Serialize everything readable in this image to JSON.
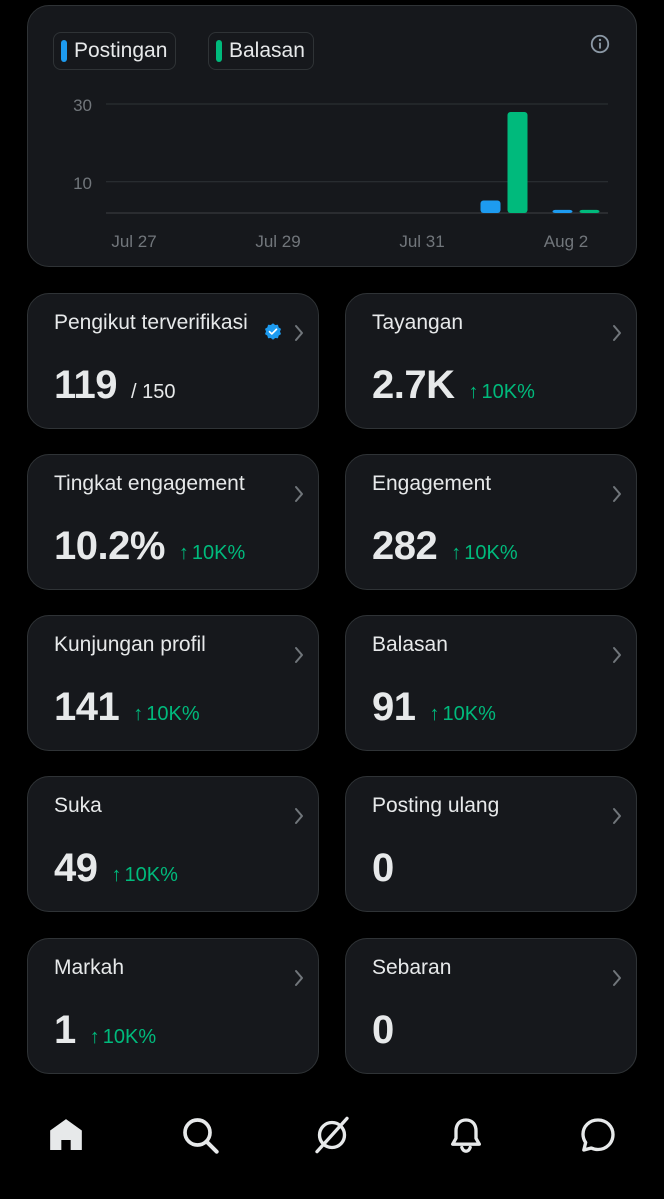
{
  "chart": {
    "legend": [
      {
        "label": "Postingan",
        "color": "#1d9bf0"
      },
      {
        "label": "Balasan",
        "color": "#00ba7c"
      }
    ]
  },
  "chart_data": {
    "type": "bar",
    "x_ticks": [
      "Jul 27",
      "Jul 29",
      "Jul 31",
      "Aug 2"
    ],
    "y_ticks": [
      10,
      30
    ],
    "ylim": [
      0,
      33
    ],
    "categories": [
      "Jul 27",
      "Jul 28",
      "Jul 29",
      "Jul 30",
      "Jul 31",
      "Aug 1",
      "Aug 2"
    ],
    "series": [
      {
        "name": "Postingan",
        "color": "#1d9bf0",
        "values": [
          0,
          0,
          0,
          0,
          0,
          4,
          1
        ]
      },
      {
        "name": "Balasan",
        "color": "#00ba7c",
        "values": [
          0,
          0,
          0,
          0,
          0,
          31,
          1
        ]
      }
    ],
    "grid": true
  },
  "stats": [
    {
      "label": "Pengikut terverifikasi",
      "value": "119",
      "sub": "/ 150",
      "verified": true
    },
    {
      "label": "Tayangan",
      "value": "2.7K",
      "change": "10K%"
    },
    {
      "label": "Tingkat engagement",
      "value": "10.2%",
      "change": "10K%"
    },
    {
      "label": "Engagement",
      "value": "282",
      "change": "10K%"
    },
    {
      "label": "Kunjungan profil",
      "value": "141",
      "change": "10K%"
    },
    {
      "label": "Balasan",
      "value": "91",
      "change": "10K%"
    },
    {
      "label": "Suka",
      "value": "49",
      "change": "10K%"
    },
    {
      "label": "Posting ulang",
      "value": "0"
    },
    {
      "label": "Markah",
      "value": "1",
      "change": "10K%"
    },
    {
      "label": "Sebaran",
      "value": "0"
    }
  ],
  "change_arrow": "↑",
  "nav": [
    {
      "icon": "home-icon",
      "active": true
    },
    {
      "icon": "search-icon"
    },
    {
      "icon": "grok-icon"
    },
    {
      "icon": "bell-icon"
    },
    {
      "icon": "messages-icon"
    }
  ]
}
